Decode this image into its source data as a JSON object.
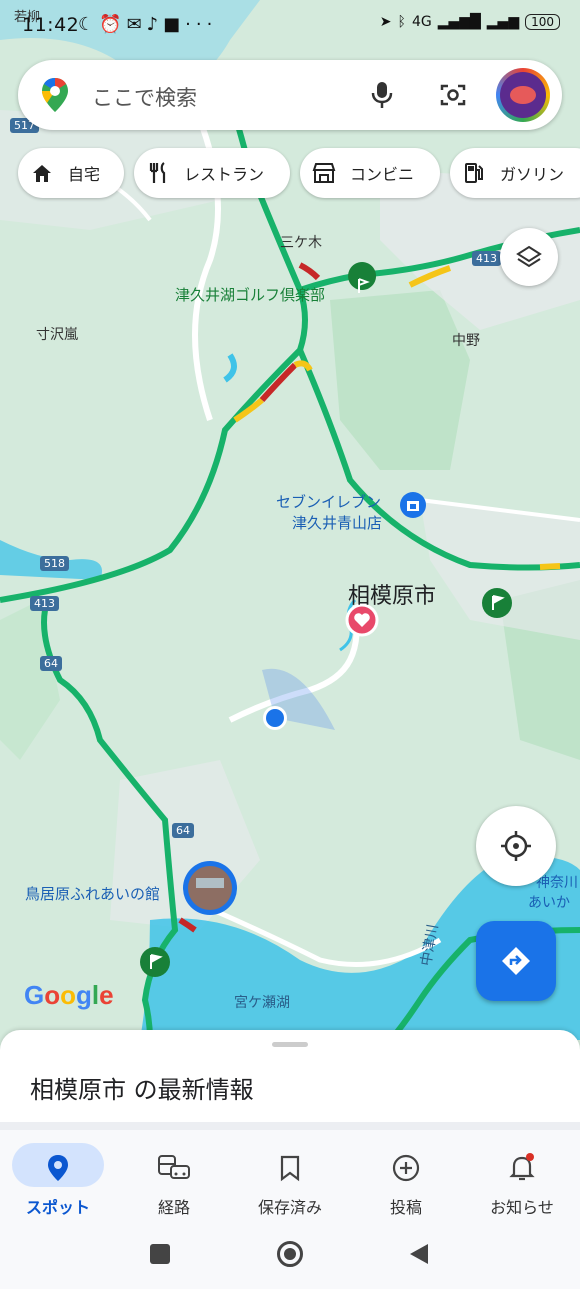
{
  "status_bar": {
    "carrier_label": "若柳",
    "time": "11:42",
    "network": "4G",
    "battery": "100"
  },
  "search": {
    "placeholder": "ここで検索"
  },
  "chips": [
    {
      "label": "自宅",
      "icon": "home-icon"
    },
    {
      "label": "レストラン",
      "icon": "restaurant-icon"
    },
    {
      "label": "コンビニ",
      "icon": "store-icon"
    },
    {
      "label": "ガソリン",
      "icon": "gas-station-icon"
    }
  ],
  "map": {
    "labels": {
      "mikagi": "三ケ木",
      "golf": "津久井湖ゴルフ倶楽部",
      "sunzawa": "寸沢嵐",
      "nakano": "中野",
      "seven_line1": "セブンイレブン",
      "seven_line2": "津久井青山店",
      "sagamihara": "相模原市",
      "toriibara": "鳥居原ふれあいの館",
      "miyagase": "宮ケ瀬湖",
      "nakatsugawa": "中津川",
      "kanagawa_line1": "神奈川",
      "kanagawa_line2": "あいか"
    },
    "route_shields": [
      "517",
      "413",
      "518",
      "413",
      "64",
      "64"
    ],
    "google_logo": "Google",
    "colors": {
      "land": "#d4eadc",
      "forest": "#bfe3c9",
      "water": "#3fc3e8",
      "road_green": "#17b26a",
      "road_yellow": "#f5c518",
      "road_red": "#c62828",
      "location_dot": "#1a73e8"
    }
  },
  "sheet": {
    "title": "相模原市 の最新情報"
  },
  "nav": {
    "items": [
      {
        "label": "スポット",
        "icon": "explore-pin-icon",
        "active": true
      },
      {
        "label": "経路",
        "icon": "commute-icon",
        "active": false
      },
      {
        "label": "保存済み",
        "icon": "bookmark-icon",
        "active": false
      },
      {
        "label": "投稿",
        "icon": "add-circle-icon",
        "active": false
      },
      {
        "label": "お知らせ",
        "icon": "bell-icon",
        "active": false
      }
    ]
  }
}
